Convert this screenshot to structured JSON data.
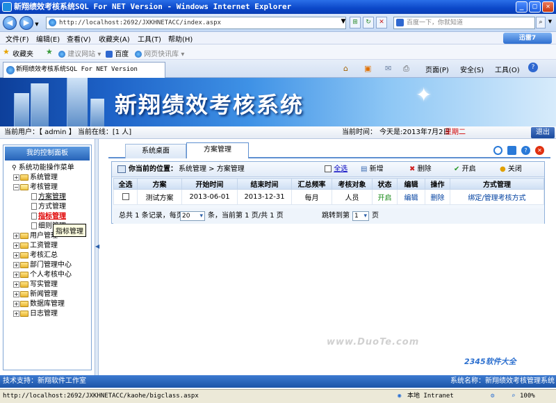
{
  "window": {
    "title": "新翔绩效考核系统SQL For NET Version - Windows Internet Explorer",
    "url": "http://localhost:2692/JXKHNETACC/index.aspx",
    "search_placeholder": "百度一下，你就知道"
  },
  "menubar": {
    "items": [
      "文件(F)",
      "编辑(E)",
      "查看(V)",
      "收藏夹(A)",
      "工具(T)",
      "帮助(H)"
    ],
    "xunlei": "迅雷7"
  },
  "favbar": {
    "favorites": "收藏夹",
    "links": [
      "建议网站",
      "百度",
      "网页快讯库"
    ]
  },
  "tab": {
    "title": "新翔绩效考核系统SQL For NET Version",
    "commands": [
      "页面(P)",
      "安全(S)",
      "工具(O)"
    ]
  },
  "banner": {
    "title": "新翔绩效考核系统"
  },
  "status": {
    "current_user": "当前用户：【 admin 】 当前在线：[1 人]",
    "time_label": "当前时间：",
    "today": "今天是:2013年7月2日",
    "weekday": "星期二",
    "logout": "退出"
  },
  "sidebar": {
    "header": "我的控制面板",
    "root": "系统功能操作菜单",
    "nodes": [
      {
        "label": "系统管理",
        "type": "folder"
      },
      {
        "label": "考核管理",
        "type": "folder-open"
      },
      {
        "label": "方案管理",
        "type": "page"
      },
      {
        "label": "方式管理",
        "type": "page"
      },
      {
        "label": "指标管理",
        "type": "page"
      },
      {
        "label": "细则管理",
        "type": "page"
      },
      {
        "label": "用户管理",
        "type": "folder"
      },
      {
        "label": "工资管理",
        "type": "folder"
      },
      {
        "label": "考核汇总",
        "type": "folder"
      },
      {
        "label": "部门管理中心",
        "type": "folder"
      },
      {
        "label": "个人考核中心",
        "type": "folder"
      },
      {
        "label": "写实管理",
        "type": "folder"
      },
      {
        "label": "新闻管理",
        "type": "folder"
      },
      {
        "label": "数据库管理",
        "type": "folder"
      },
      {
        "label": "日志管理",
        "type": "folder"
      }
    ],
    "tooltip": "指标管理"
  },
  "main": {
    "tabs": [
      "系统桌面",
      "方案管理"
    ],
    "location": "你当前的位置：",
    "breadcrumb": "系统管理 > 方案管理",
    "actions": {
      "select_all": "全选",
      "add": "新增",
      "delete": "删除",
      "enable": "开启",
      "disable": "关闭"
    },
    "columns": [
      "全选",
      "方案",
      "开始时间",
      "结束时间",
      "汇总频率",
      "考核对象",
      "状态",
      "编辑",
      "操作",
      "方式管理"
    ],
    "rows": [
      [
        "",
        "测试方案",
        "2013-06-01",
        "2013-12-31",
        "每月",
        "人员",
        "开启",
        "编辑",
        "删除",
        "绑定/管理考核方式"
      ]
    ],
    "pager": {
      "total": "总共 1 条记录，每页",
      "per_page": "20",
      "page_info": "条，当前第 1 页/共 1 页",
      "jump": "跳转到第",
      "page": "1",
      "page_suffix": "页"
    }
  },
  "footer": {
    "support": "技术支持：新翔软件工作室",
    "system": "系统名称：新翔绩效考核管理系统"
  },
  "iestatus": {
    "link": "http://localhost:2692/JXKHNETACC/kaohe/bigclass.aspx",
    "zone": "本地 Intranet",
    "zoom": "100%"
  },
  "watermarks": {
    "duote": "www.DuoTe.com",
    "brand": "2345软件大全"
  }
}
